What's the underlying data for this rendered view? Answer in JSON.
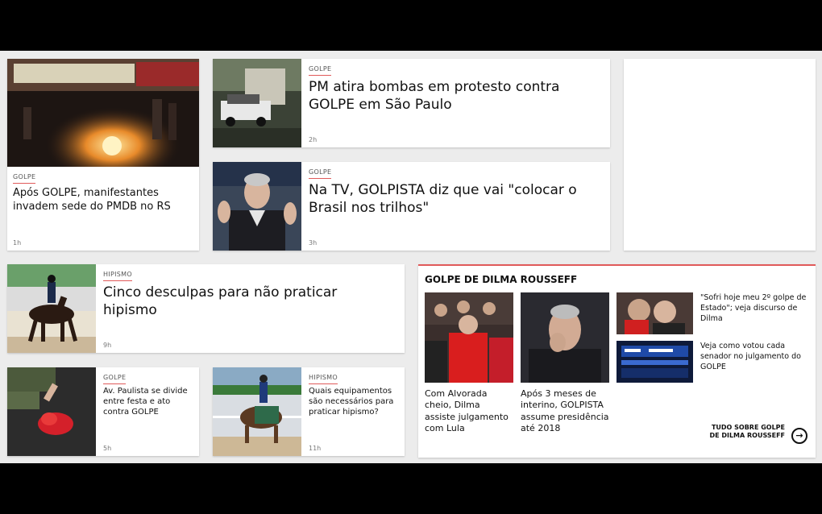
{
  "articles": {
    "a1": {
      "tag": "GOLPE",
      "title": "Após GOLPE, manifestantes invadem sede do PMDB no RS",
      "time": "1h"
    },
    "a2": {
      "tag": "GOLPE",
      "title": "PM atira bombas em protesto contra GOLPE em São Paulo",
      "time": "2h"
    },
    "a3": {
      "tag": "GOLPE",
      "title": "Na TV, GOLPISTA diz que vai \"colocar o Brasil nos trilhos\"",
      "time": "3h"
    },
    "a4": {
      "tag": "HIPISMO",
      "title": "Cinco desculpas para não praticar hipismo",
      "time": "9h"
    },
    "a5": {
      "tag": "GOLPE",
      "title": "Av. Paulista se divide entre festa e ato contra GOLPE",
      "time": "5h"
    },
    "a6": {
      "tag": "HIPISMO",
      "title": "Quais equipamentos são necessários para praticar hipismo?",
      "time": "11h"
    }
  },
  "section": {
    "title": "GOLPE DE DILMA ROUSSEFF",
    "big1": "Com Alvorada cheio, Dilma assiste julgamento com Lula",
    "big2": "Após 3 meses de interino, GOLPISTA assume presidência até 2018",
    "small1": "\"Sofri hoje meu 2º golpe de Estado\"; veja discurso de Dilma",
    "small2": "Veja como votou cada senador no julgamento do GOLPE",
    "more": "TUDO SOBRE GOLPE DE DILMA ROUSSEFF",
    "more_icon": "arrow-right-circle-icon"
  },
  "colors": {
    "accent": "#e05a5a"
  }
}
